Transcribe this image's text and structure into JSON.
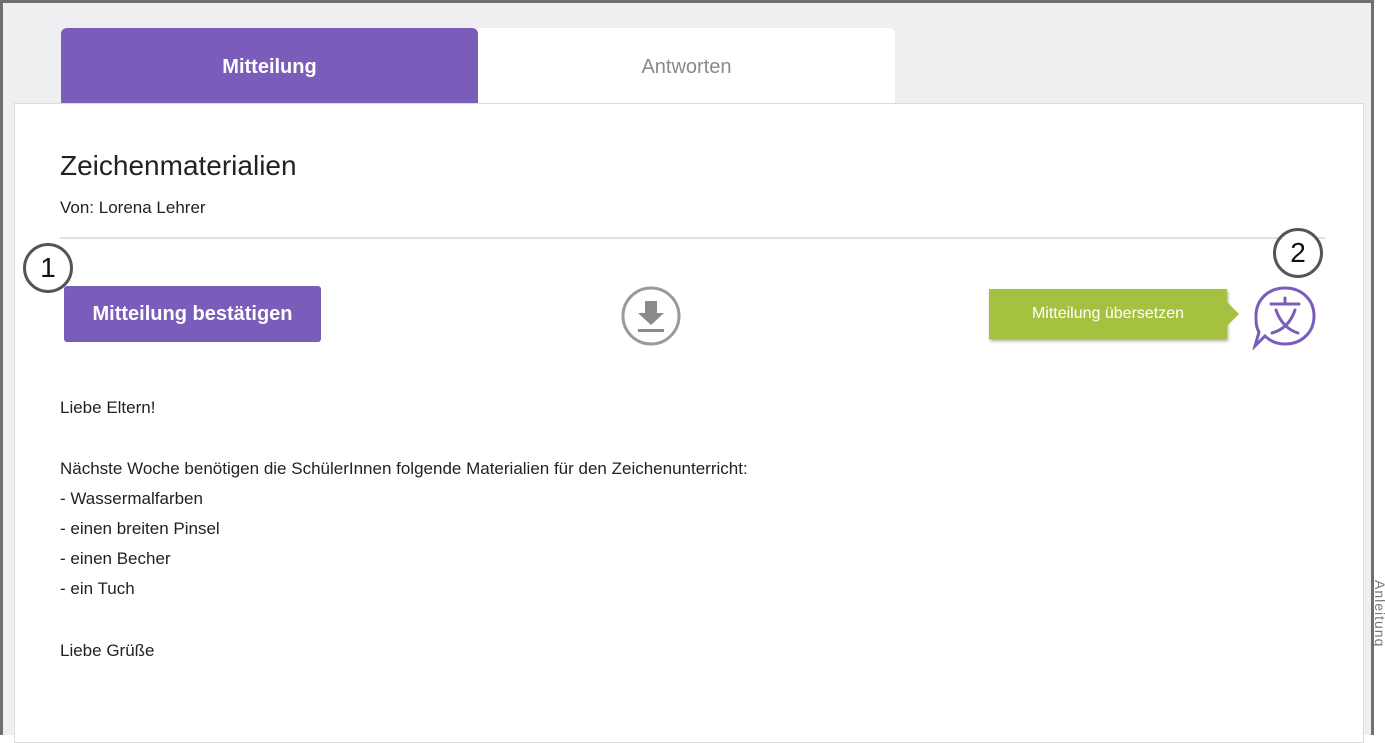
{
  "tabs": {
    "active_label": "Mitteilung",
    "inactive_label": "Antworten"
  },
  "message": {
    "title": "Zeichenmaterialien",
    "sender": "Von: Lorena Lehrer",
    "greeting": "Liebe Eltern!",
    "intro": "Nächste Woche benötigen die SchülerInnen folgende Materialien für den Zeichenunterricht:",
    "items": [
      "- Wassermalfarben",
      "- einen breiten Pinsel",
      "- einen Becher",
      "- ein Tuch"
    ],
    "closing": "Liebe Grüße"
  },
  "actions": {
    "confirm_label": "Mitteilung bestätigen",
    "download_icon": "download-icon",
    "translate_label": "Mitteilung übersetzen",
    "translate_icon": "translate-icon"
  },
  "markers": [
    "1",
    "2"
  ],
  "side_caption": "Anleitung",
  "colors": {
    "accent_purple": "#7a5cba",
    "translate_green": "#a4c23f",
    "icon_gray": "#9a9a9a"
  }
}
